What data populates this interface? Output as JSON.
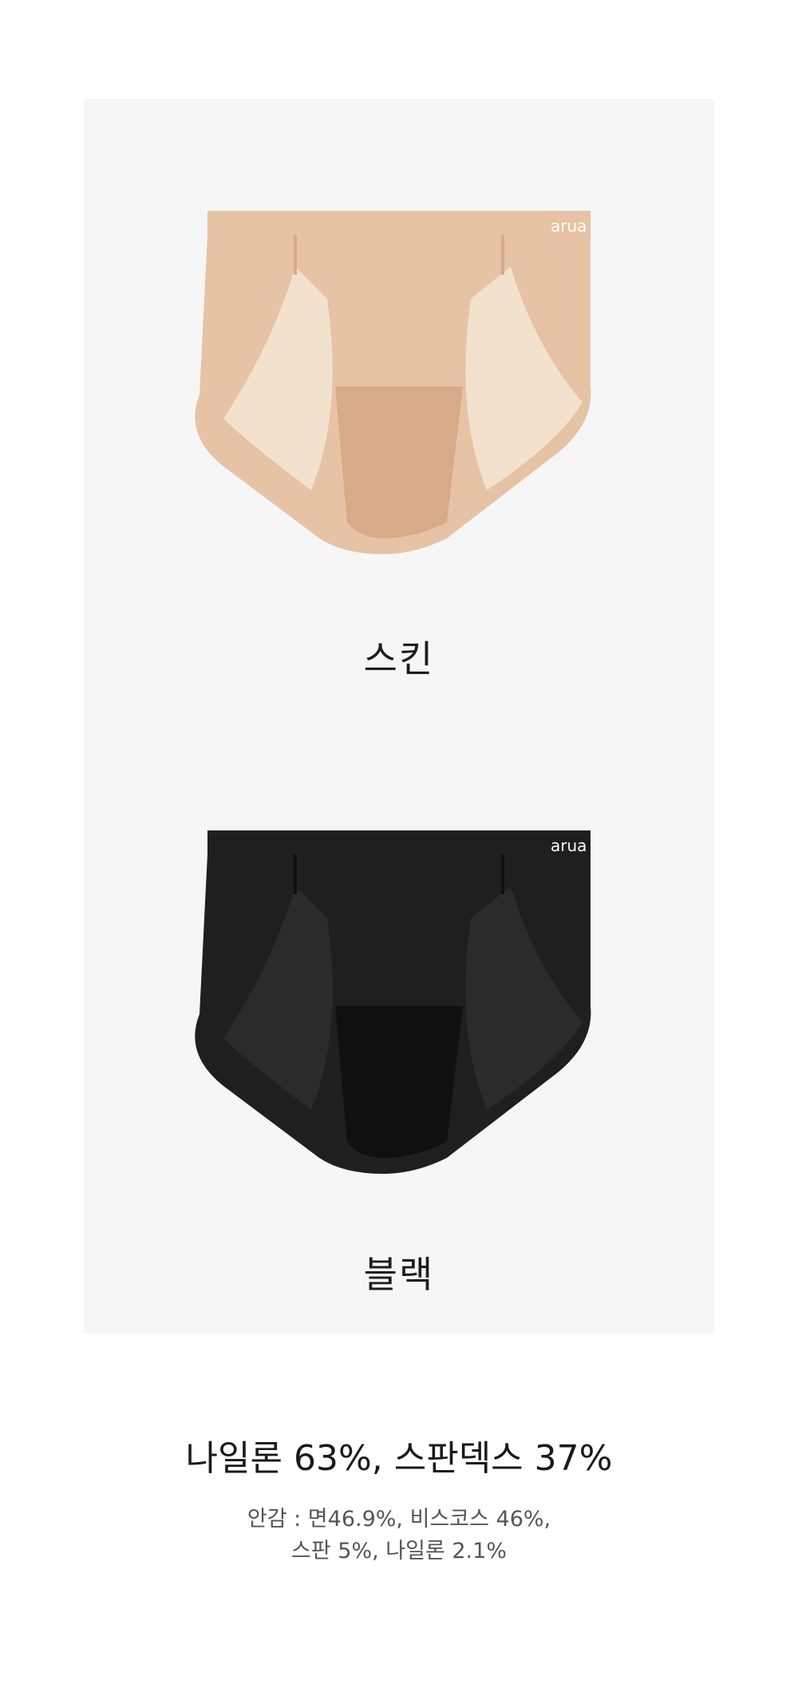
{
  "products": [
    {
      "color_label": "스킨",
      "fabric_color": "#e6c3a4",
      "shade_color": "#d7ab89",
      "lining_color": "#f2e1cc",
      "logo_text": "arua"
    },
    {
      "color_label": "블랙",
      "fabric_color": "#1f1f1f",
      "shade_color": "#101010",
      "lining_color": "#2b2b2b",
      "logo_text": "arua"
    }
  ],
  "material": {
    "main": "나일론 63%, 스판덱스 37%",
    "lining_line1": "안감 :  면46.9%, 비스코스 46%,",
    "lining_line2": "스판 5%, 나일론 2.1%"
  }
}
